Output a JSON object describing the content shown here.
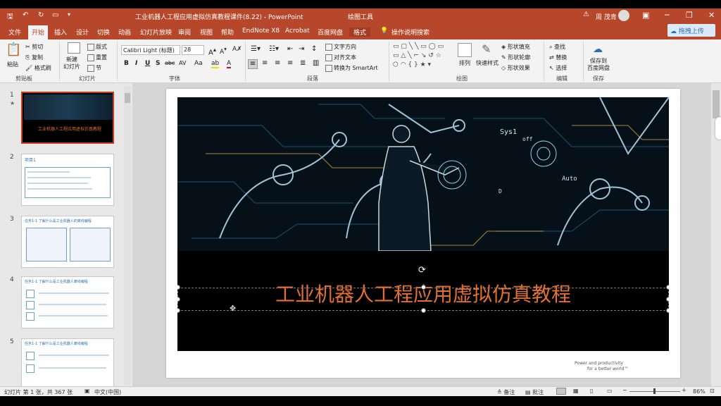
{
  "window": {
    "title": "工业机器人工程应用虚拟仿真教程课件(8.22)  -  PowerPoint",
    "contextual_tab": "绘图工具",
    "user": "周 茂青",
    "upload_button": "拖拽上传"
  },
  "tabs": [
    "文件",
    "开始",
    "插入",
    "设计",
    "切换",
    "动画",
    "幻灯片放映",
    "审阅",
    "视图",
    "帮助",
    "EndNote X8",
    "Acrobat",
    "百度网盘",
    "格式"
  ],
  "tell_me": "操作说明搜索",
  "ribbon": {
    "clipboard": {
      "paste": "粘贴",
      "cut": "剪切",
      "copy": "复制",
      "format_painter": "格式刷",
      "label": "剪贴板"
    },
    "slides": {
      "new_slide": "新建\n幻灯片",
      "layout": "版式",
      "reset": "重置",
      "section": "节",
      "label": "幻灯片"
    },
    "font": {
      "font_name": "Calibri Light (标题)",
      "font_size": "28",
      "label": "字体",
      "bold": "B",
      "italic": "I",
      "underline": "U",
      "strike": "S",
      "shadow": "abc",
      "spacing": "AV",
      "case": "Aa"
    },
    "paragraph": {
      "text_direction": "文字方向",
      "align_text": "对齐文本",
      "smartart": "转换为 SmartArt",
      "label": "段落"
    },
    "drawing": {
      "arrange": "排列",
      "quick_styles": "快速样式",
      "shape_fill": "形状填充",
      "shape_outline": "形状轮廓",
      "shape_effects": "形状效果",
      "label": "绘图"
    },
    "editing": {
      "find": "查找",
      "replace": "替换",
      "select": "选择",
      "label": "编辑"
    },
    "save": {
      "save_to": "保存到\n百度网盘",
      "label": "保存"
    }
  },
  "thumbnails": [
    {
      "num": "1",
      "title": "工业机器人工程应用虚拟仿真教程"
    },
    {
      "num": "2",
      "title": "项目1"
    },
    {
      "num": "3",
      "title": "任务1-1 了解什么是工业机器人的离线编程"
    },
    {
      "num": "4",
      "title": "任务1-1 了解什么是工业机器人离线编程"
    },
    {
      "num": "5",
      "title": "任务1-1 了解什么是工业机器人离线编程"
    }
  ],
  "slide": {
    "title": "工业机器人工程应用虚拟仿真教程",
    "footer_line1": "Power and productivity",
    "footer_line2": "for a better world™",
    "scene_text_sys": "Sys1",
    "scene_text_auto": "Auto",
    "scene_text_off": "off",
    "scene_text_d": "D"
  },
  "status": {
    "slide_info": "幻灯片 第 1 张，共 367 张",
    "language": "中文(中国)",
    "notes": "备注",
    "comments": "批注",
    "zoom": "86%"
  },
  "colors": {
    "accent": "#b7472a",
    "title_orange": "#e0702f"
  }
}
